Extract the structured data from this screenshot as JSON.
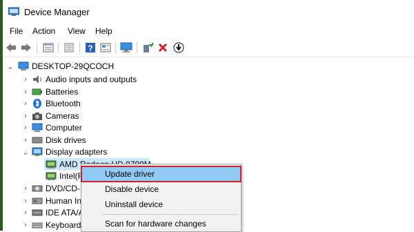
{
  "window": {
    "title": "Device Manager"
  },
  "menu": {
    "file": "File",
    "action": "Action",
    "view": "View",
    "help": "Help"
  },
  "toolbar": {
    "icons": [
      "back-arrow-icon",
      "forward-arrow-icon",
      "properties-icon",
      "list-icon",
      "help-icon",
      "details-icon",
      "monitor-icon",
      "add-driver-icon",
      "remove-icon",
      "download-icon"
    ]
  },
  "tree": {
    "root": "DESKTOP-29QCOCH",
    "items": [
      {
        "label": "Audio inputs and outputs",
        "icon": "speaker-icon"
      },
      {
        "label": "Batteries",
        "icon": "battery-icon"
      },
      {
        "label": "Bluetooth",
        "icon": "bluetooth-icon"
      },
      {
        "label": "Cameras",
        "icon": "camera-icon"
      },
      {
        "label": "Computer",
        "icon": "computer-icon"
      },
      {
        "label": "Disk drives",
        "icon": "disk-icon"
      },
      {
        "label": "Display adapters",
        "icon": "display-adapter-icon"
      }
    ],
    "children": [
      {
        "label": "AMD Radeon HD 8700M",
        "icon": "gpu-icon"
      },
      {
        "label": "Intel(R",
        "icon": "gpu-icon"
      }
    ],
    "more": [
      {
        "label": "DVD/CD-R",
        "icon": "dvd-icon"
      },
      {
        "label": "Human In",
        "icon": "hid-icon"
      },
      {
        "label": "IDE ATA/A",
        "icon": "ide-icon"
      },
      {
        "label": "Keyboards",
        "icon": "keyboard-icon"
      }
    ]
  },
  "context_menu": {
    "update": "Update driver",
    "disable": "Disable device",
    "uninstall": "Uninstall device",
    "scan": "Scan for hardware changes"
  },
  "colors": {
    "selection": "#cce8ff",
    "highlight": "#91c9f7",
    "callout": "#d0202e"
  }
}
